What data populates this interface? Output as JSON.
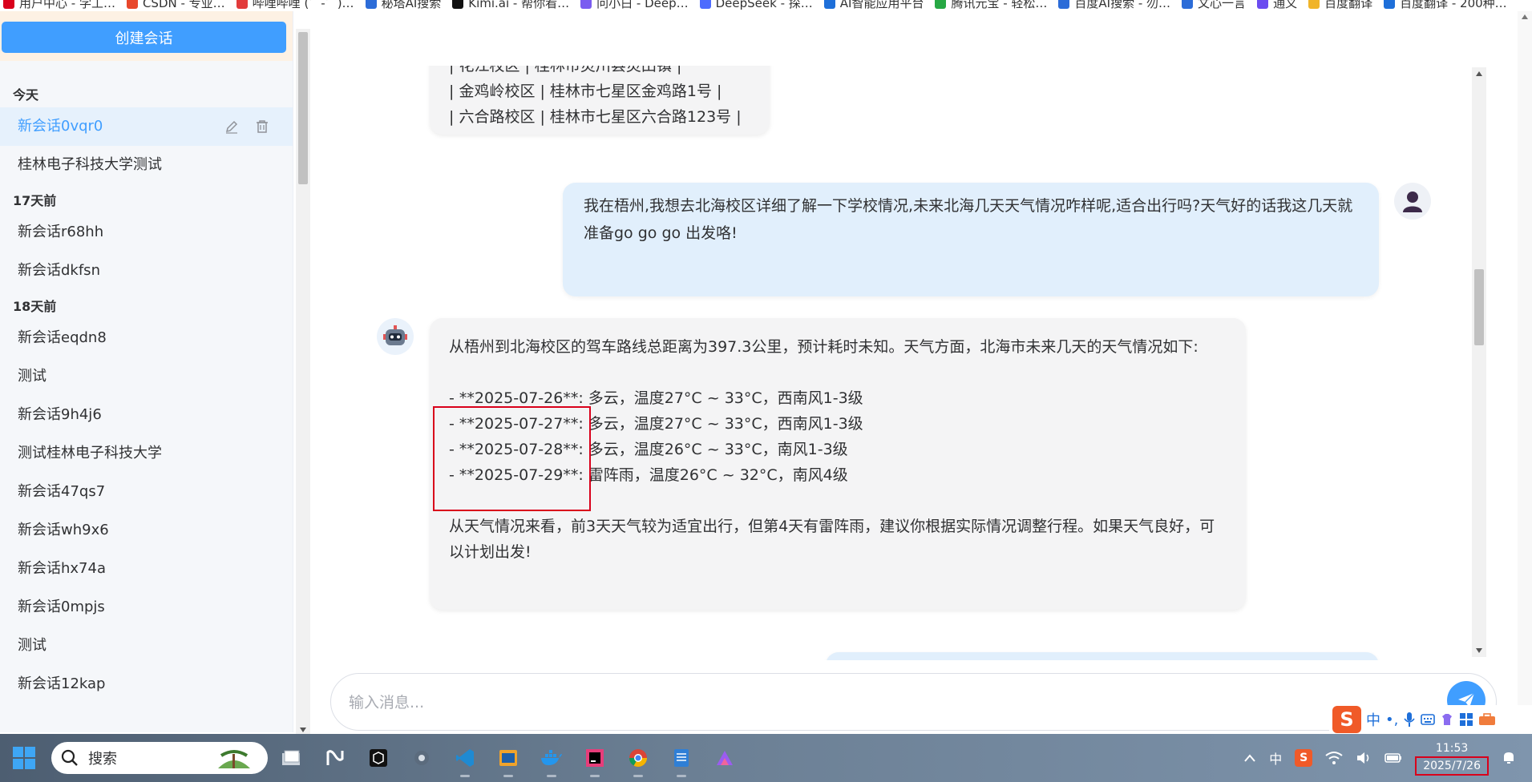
{
  "bookmarks": [
    "用户中心 - 学工…",
    "CSDN - 专业…",
    "哔哩哔哩 (゜-゜)…",
    "秘塔AI搜索",
    "Kimi.ai - 帮你看…",
    "问小白 - Deep…",
    "DeepSeek - 探…",
    "AI智能应用平台",
    "腾讯元宝 - 轻松…",
    "百度AI搜索 - 勿…",
    "文心一言",
    "通义",
    "百度翻译",
    "百度翻译 - 200种…"
  ],
  "sidebar": {
    "new_chat_label": "创建会话",
    "groups": [
      {
        "label": "今天",
        "items": [
          {
            "label": "新会话0vqr0",
            "active": true
          },
          {
            "label": "桂林电子科技大学测试"
          }
        ]
      },
      {
        "label": "17天前",
        "items": [
          {
            "label": "新会话r68hh"
          },
          {
            "label": "新会话dkfsn"
          }
        ]
      },
      {
        "label": "18天前",
        "items": [
          {
            "label": "新会话eqdn8"
          },
          {
            "label": "测试"
          },
          {
            "label": "新会话9h4j6"
          },
          {
            "label": "测试桂林电子科技大学"
          },
          {
            "label": "新会话47qs7"
          },
          {
            "label": "新会话wh9x6"
          },
          {
            "label": "新会话hx74a"
          },
          {
            "label": "新会话0mpjs"
          },
          {
            "label": "测试"
          },
          {
            "label": "新会话12kap"
          }
        ]
      }
    ]
  },
  "messages": {
    "ai_top_lines": [
      "| 花江校区 | 桂林市灵川县灵田镇 |",
      "| 金鸡岭校区 | 桂林市七星区金鸡路1号 |",
      "| 六合路校区 | 桂林市七星区六合路123号 |"
    ],
    "user_text": "我在梧州,我想去北海校区详细了解一下学校情况,未来北海几天天气情况咋样呢,适合出行吗?天气好的话我这几天就准备go go go 出发咯!",
    "ai_intro": "从梧州到北海校区的驾车路线总距离为397.3公里，预计耗时未知。天气方面，北海市未来几天的天气情况如下:",
    "weather": [
      {
        "date": "- **2025-07-26**:",
        "desc": " 多云，温度27°C ~ 33°C，西南风1-3级"
      },
      {
        "date": "- **2025-07-27**:",
        "desc": " 多云，温度27°C ~ 33°C，西南风1-3级"
      },
      {
        "date": "- **2025-07-28**:",
        "desc": " 多云，温度26°C ~ 33°C，南风1-3级"
      },
      {
        "date": "- **2025-07-29**:",
        "desc": " 雷阵雨，温度26°C ~ 32°C，南风4级"
      }
    ],
    "ai_conclusion": "从天气情况来看，前3天天气较为适宜出行，但第4天有雷阵雨，建议你根据实际情况调整行程。如果天气良好，可以计划出发!"
  },
  "input": {
    "placeholder": "输入消息..."
  },
  "ime": {
    "lang": "中",
    "punct": "•,"
  },
  "taskbar": {
    "search_label": "搜索",
    "apps": [
      "file-explorer",
      "notion",
      "jetbrains-toolbox",
      "settings",
      "vscode",
      "windows-terminal",
      "docker",
      "intellij-idea",
      "chrome",
      "notepad",
      "app"
    ],
    "tray_lang": "中",
    "time": "11:53",
    "date": "2025/7/26"
  },
  "colors": {
    "primary": "#409eff",
    "highlight": "#d9001b",
    "user_bubble": "#e1effc",
    "ai_bubble": "#f4f4f5"
  }
}
